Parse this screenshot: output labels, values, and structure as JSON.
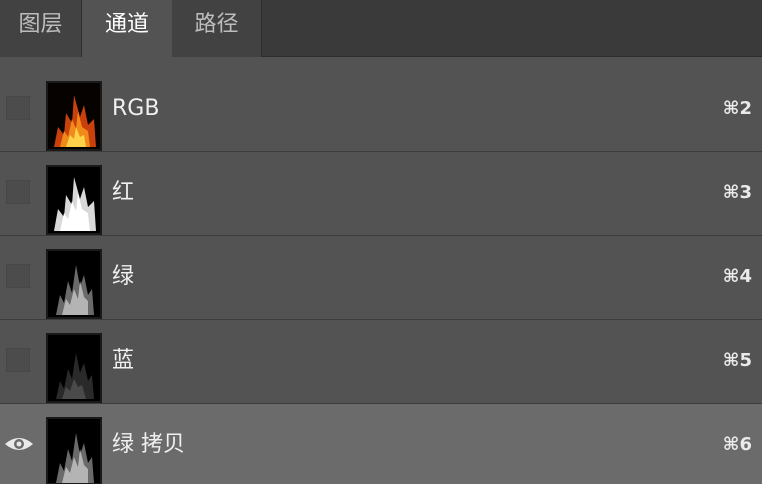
{
  "tabs": [
    {
      "label": "图层",
      "active": false
    },
    {
      "label": "通道",
      "active": true
    },
    {
      "label": "路径",
      "active": false
    }
  ],
  "channels": [
    {
      "name": "RGB",
      "shortcut": "⌘2",
      "visible": false,
      "selected": false,
      "thumbnail": "color-flame"
    },
    {
      "name": "红",
      "shortcut": "⌘3",
      "visible": false,
      "selected": false,
      "thumbnail": "bright-flame"
    },
    {
      "name": "绿",
      "shortcut": "⌘4",
      "visible": false,
      "selected": false,
      "thumbnail": "mid-flame"
    },
    {
      "name": "蓝",
      "shortcut": "⌘5",
      "visible": false,
      "selected": false,
      "thumbnail": "dark-flame"
    },
    {
      "name": "绿 拷贝",
      "shortcut": "⌘6",
      "visible": true,
      "selected": true,
      "thumbnail": "mid-flame"
    }
  ],
  "colors": {
    "panel_bg": "#535353",
    "tabbar_bg": "#3a3a3a",
    "selected_row_bg": "#6b6b6b",
    "text": "#f0f0f0"
  },
  "icons": {
    "visibility": "eye-icon"
  }
}
